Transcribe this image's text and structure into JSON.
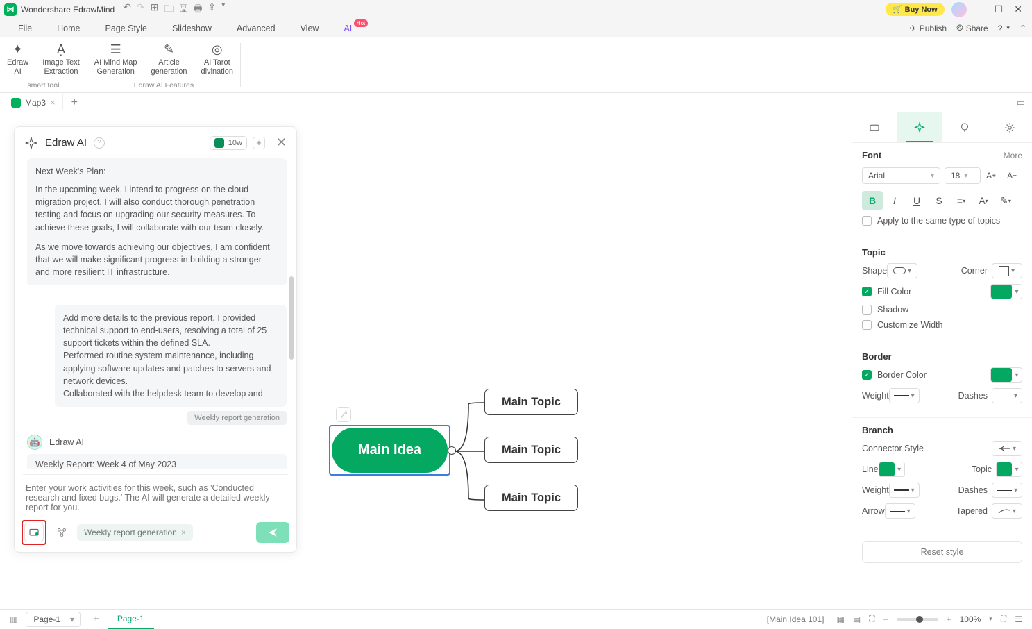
{
  "app": {
    "name": "Wondershare EdrawMind",
    "buy": "Buy Now"
  },
  "menu": {
    "items": [
      "File",
      "Home",
      "Page Style",
      "Slideshow",
      "Advanced",
      "View",
      "AI"
    ],
    "active": 6,
    "hot_on": 6,
    "publish": "Publish",
    "share": "Share"
  },
  "ribbon": {
    "group1": {
      "caption": "smart tool",
      "tools": [
        {
          "icon": "✦",
          "label": "Edraw\nAI"
        },
        {
          "icon": "⧉",
          "label": "Image Text\nExtraction"
        }
      ]
    },
    "group2": {
      "caption": "Edraw AI Features",
      "tools": [
        {
          "icon": "☰",
          "label": "AI Mind Map\nGeneration"
        },
        {
          "icon": "✎",
          "label": "Article\ngeneration"
        },
        {
          "icon": "◎",
          "label": "AI Tarot\ndivination"
        }
      ]
    }
  },
  "doctab": {
    "name": "Map3"
  },
  "ai": {
    "title": "Edraw AI",
    "tokens": "10w",
    "plan_heading": "Next Week's Plan:",
    "plan_p1": "In the upcoming week, I intend to progress on the cloud migration project. I will also conduct thorough penetration testing and focus on upgrading our security measures. To achieve these goals, I will collaborate with our team closely.",
    "plan_p2": "As we move towards achieving our objectives, I am confident that we will make significant progress in building a stronger and more resilient IT infrastructure.",
    "user_msg": "Add more details to the previous report. I provided technical support to end-users, resolving a total of 25 support tickets within the defined SLA.\nPerformed routine system maintenance, including applying software updates and patches to servers and network devices.\nCollaborated with the helpdesk team to develop and",
    "tag": "Weekly report generation",
    "bot_name": "Edraw AI",
    "report_line": "Weekly Report: Week 4 of May 2023",
    "placeholder": "Enter your work activities for this week, such as 'Conducted research and fixed bugs.' The AI will generate a detailed weekly report for you.",
    "mode": "Weekly report generation"
  },
  "mindmap": {
    "main": "Main Idea",
    "topics": [
      "Main Topic",
      "Main Topic",
      "Main Topic"
    ]
  },
  "rp": {
    "font": {
      "title": "Font",
      "more": "More",
      "family": "Arial",
      "size": "18",
      "apply": "Apply to the same type of topics"
    },
    "topic": {
      "title": "Topic",
      "shape": "Shape",
      "corner": "Corner",
      "fill": "Fill Color",
      "shadow": "Shadow",
      "custom": "Customize Width"
    },
    "border": {
      "title": "Border",
      "color": "Border Color",
      "weight": "Weight",
      "dashes": "Dashes"
    },
    "branch": {
      "title": "Branch",
      "conn": "Connector Style",
      "line": "Line",
      "topic": "Topic",
      "weight": "Weight",
      "dashes": "Dashes",
      "arrow": "Arrow",
      "tapered": "Tapered"
    },
    "reset": "Reset style"
  },
  "status": {
    "pagesel": "Page-1",
    "pagetab": "Page-1",
    "info": "[Main Idea 101]",
    "zoom": "100%"
  },
  "colors": {
    "accent": "#05a860"
  }
}
